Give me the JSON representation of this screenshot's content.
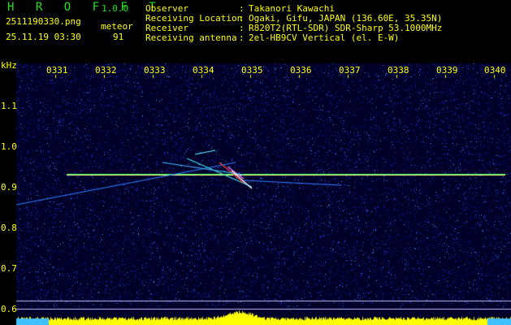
{
  "app": {
    "name": "H R O F F T",
    "version": "1.0.0"
  },
  "file": {
    "name": "2511190330.png",
    "datetime": "25.11.19 03:30"
  },
  "meteor": {
    "label": "meteor",
    "count": "91"
  },
  "info": [
    {
      "label": "Observer",
      "value": "Takanori Kawachi"
    },
    {
      "label": "Receiving Location",
      "value": "Ogaki, Gifu, JAPAN (136.60E, 35.35N)"
    },
    {
      "label": "Receiver",
      "value": "R820T2(RTL-SDR) SDR-Sharp 53.1000MHz"
    },
    {
      "label": "Receiving antenna",
      "value": "2el-HB9CV Vertical (el. E-W)"
    }
  ],
  "axis": {
    "unit": "kHz",
    "times": [
      "0331",
      "0332",
      "0333",
      "0334",
      "0335",
      "0336",
      "0337",
      "0338",
      "0339",
      "0340"
    ],
    "freqs": [
      "1.1",
      "1.0",
      "0.9",
      "0.8",
      "0.7",
      "0.6"
    ]
  },
  "colors": {
    "text": "#ffff00",
    "logo": "#20e020",
    "bg": "#000033"
  }
}
